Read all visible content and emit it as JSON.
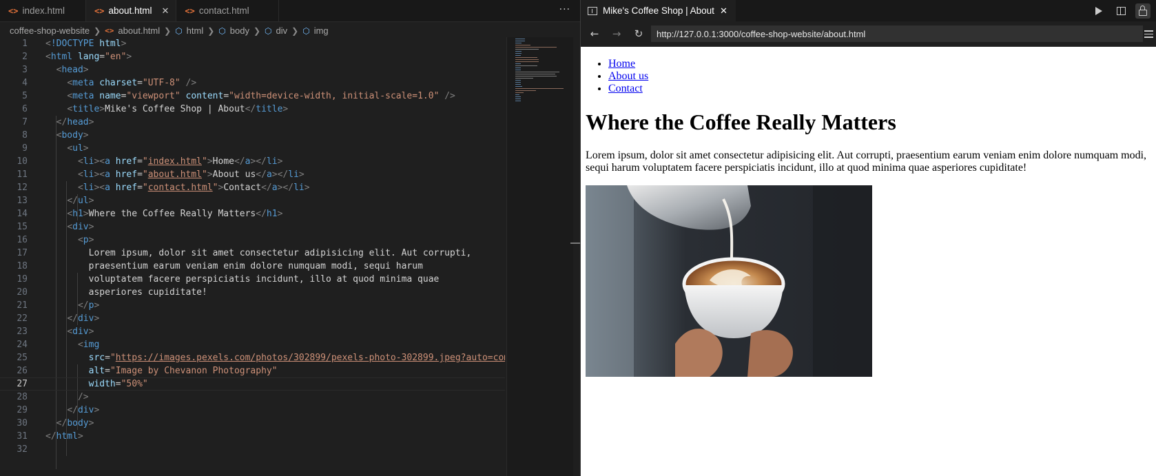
{
  "editor": {
    "tabs": [
      {
        "label": "index.html",
        "active": false
      },
      {
        "label": "about.html",
        "active": true
      },
      {
        "label": "contact.html",
        "active": false
      }
    ],
    "more_label": "···",
    "breadcrumb": [
      "coffee-shop-website",
      "about.html",
      "html",
      "body",
      "div",
      "img"
    ],
    "current_line": 27,
    "line_numbers": [
      "1",
      "2",
      "3",
      "4",
      "5",
      "6",
      "7",
      "8",
      "9",
      "10",
      "11",
      "12",
      "13",
      "14",
      "15",
      "16",
      "17",
      "18",
      "19",
      "20",
      "21",
      "22",
      "23",
      "24",
      "25",
      "26",
      "27",
      "28",
      "29",
      "30",
      "31",
      "32"
    ],
    "code": {
      "doctype_kw": "!DOCTYPE",
      "html_tag": "html",
      "lang_attr": "lang",
      "lang_val": "\"en\"",
      "head_tag": "head",
      "meta_tag": "meta",
      "charset_attr": "charset",
      "charset_val": "\"UTF-8\"",
      "name_attr": "name",
      "name_val": "\"viewport\"",
      "content_attr": "content",
      "content_val": "\"width=device-width, initial-scale=1.0\"",
      "title_tag": "title",
      "title_text": "Mike's Coffee Shop | About",
      "body_tag": "body",
      "ul_tag": "ul",
      "li_tag": "li",
      "a_tag": "a",
      "href_attr": "href",
      "href_1": "index.html",
      "href_2": "about.html",
      "href_3": "contact.html",
      "link_1": "Home",
      "link_2": "About us",
      "link_3": "Contact",
      "h1_tag": "h1",
      "h1_text": "Where the Coffee Really Matters",
      "div_tag": "div",
      "p_tag": "p",
      "p_line1": "Lorem ipsum, dolor sit amet consectetur adipisicing elit. Aut corrupti,",
      "p_line2": "praesentium earum veniam enim dolore numquam modi, sequi harum",
      "p_line3": "voluptatem facere perspiciatis incidunt, illo at quod minima quae",
      "p_line4": "asperiores cupiditate!",
      "img_tag": "img",
      "src_attr": "src",
      "src_val": "https://images.pexels.com/photos/302899/pexels-photo-302899.jpeg?auto=comp",
      "alt_attr": "alt",
      "alt_val": "\"Image by Chevanon Photography\"",
      "width_attr": "width",
      "width_val": "\"50%\""
    }
  },
  "browser": {
    "tab_title": "Mike's Coffee Shop | About",
    "url": "http://127.0.0.1:3000/coffee-shop-website/about.html",
    "page": {
      "nav": [
        "Home",
        "About us",
        "Contact"
      ],
      "heading": "Where the Coffee Really Matters",
      "paragraph": "Lorem ipsum, dolor sit amet consectetur adipisicing elit. Aut corrupti, praesentium earum veniam enim dolore numquam modi, sequi harum voluptatem facere perspiciatis incidunt, illo at quod minima quae asperiores cupiditate!",
      "image_alt": "Image by Chevanon Photography"
    }
  },
  "colors": {
    "editor_bg": "#1f1f1f",
    "tag": "#569cd6",
    "attr_name": "#9cdcfe",
    "attr_value": "#ce9178",
    "link": "#0000ee",
    "file_icon": "#e8743b"
  },
  "icons": {
    "file": "html-file-icon",
    "element": "symbol-element-icon",
    "back": "arrow-left-icon",
    "forward": "arrow-right-icon",
    "reload": "refresh-icon",
    "run": "play-icon",
    "split": "split-editor-icon",
    "lock": "lock-icon",
    "menu": "hamburger-menu-icon"
  }
}
